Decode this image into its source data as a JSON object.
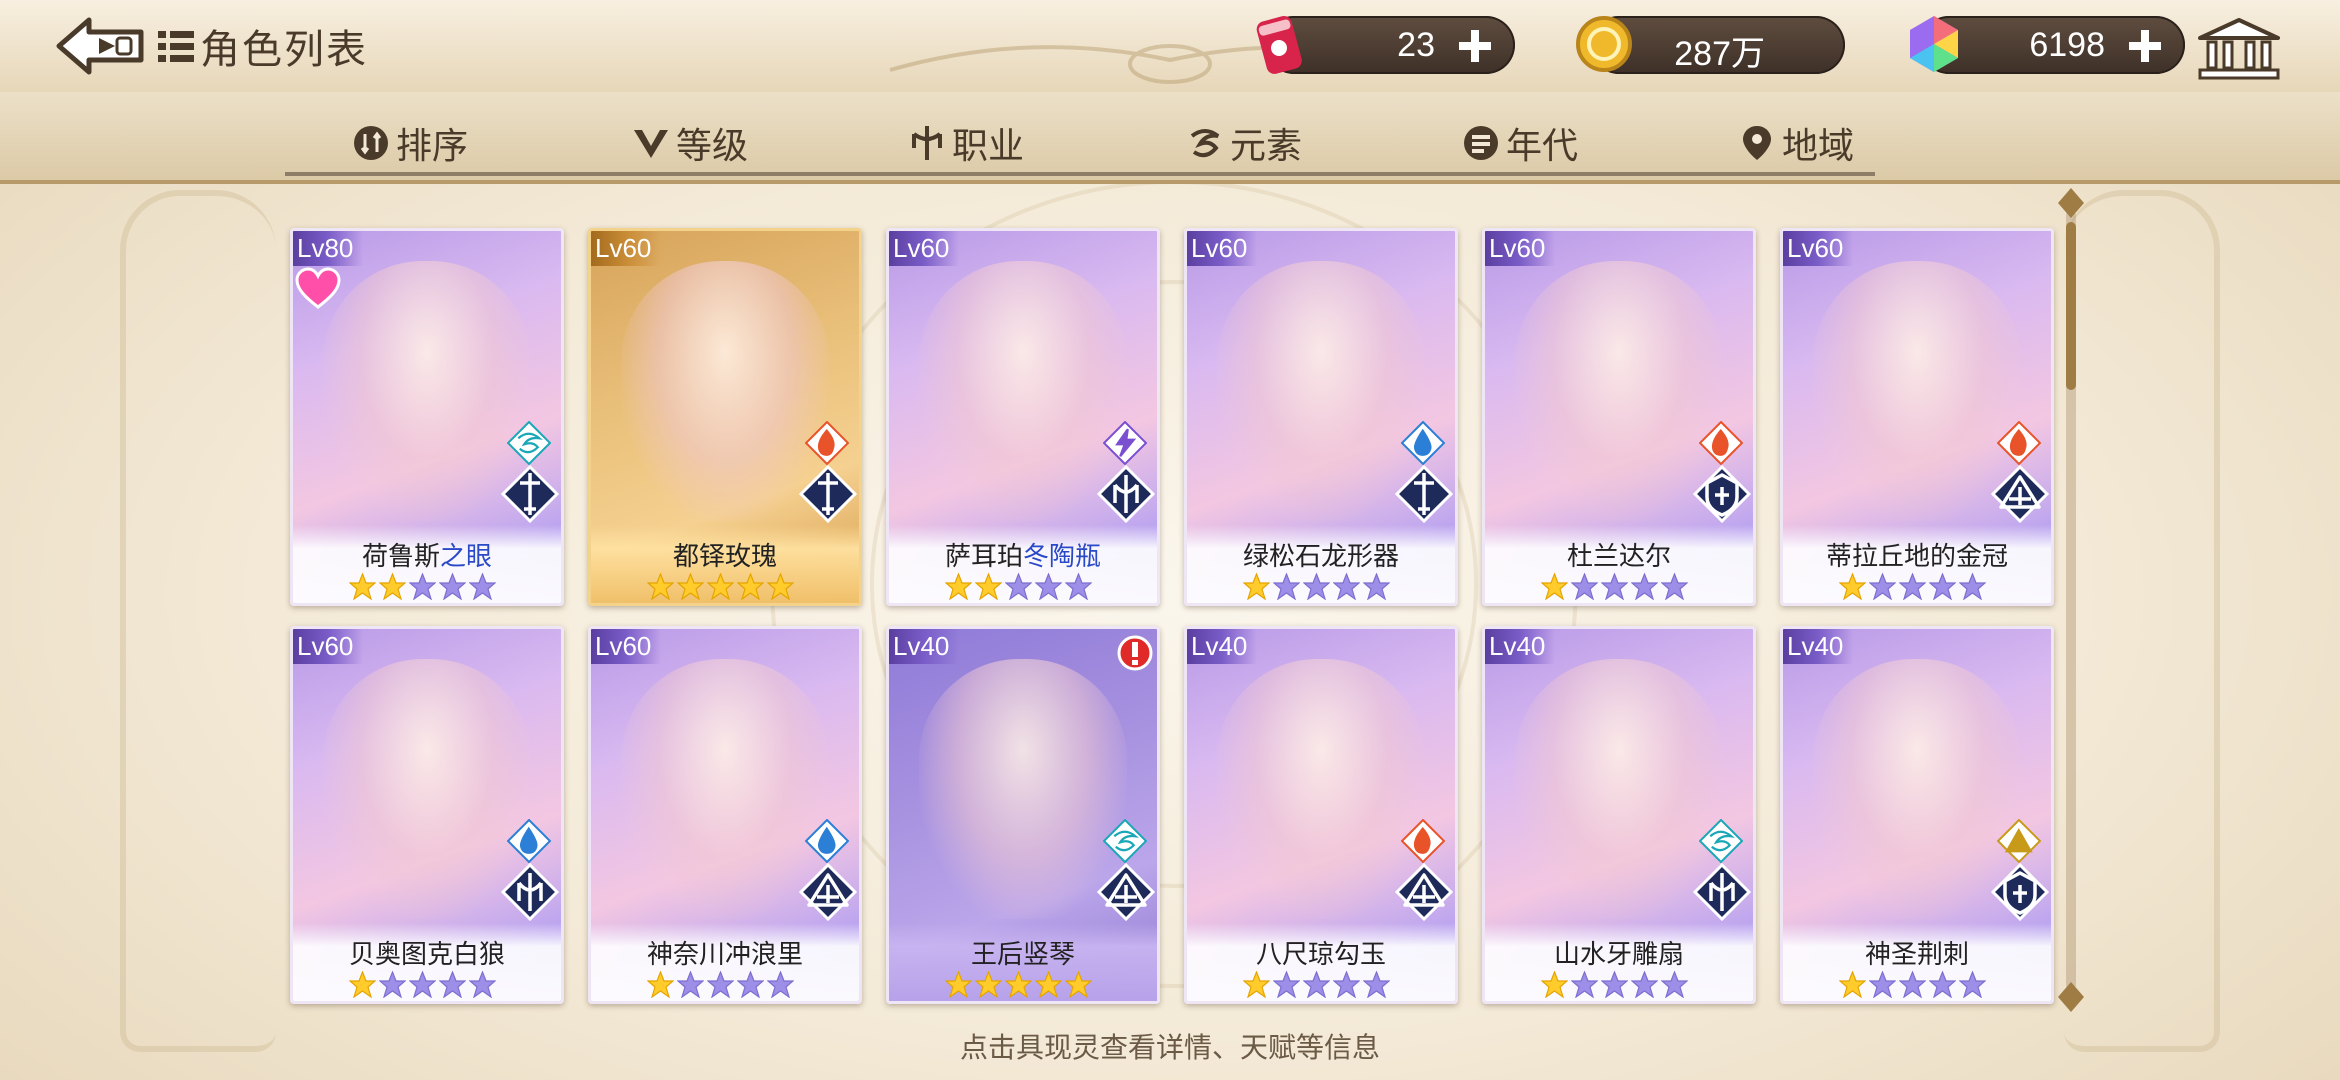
{
  "header": {
    "title": "角色列表"
  },
  "resources": {
    "ticket": "23",
    "gold": "287万",
    "gems": "6198"
  },
  "filters": [
    {
      "label": "排序",
      "icon": "sort-icon"
    },
    {
      "label": "等级",
      "icon": "level-v-icon"
    },
    {
      "label": "职业",
      "icon": "class-icon"
    },
    {
      "label": "元素",
      "icon": "element-icon"
    },
    {
      "label": "年代",
      "icon": "era-icon"
    },
    {
      "label": "地域",
      "icon": "location-pin-icon"
    }
  ],
  "cards": [
    {
      "level": "Lv80",
      "name": "荷鲁斯",
      "name_hl": "之眼",
      "stars": 2,
      "element": "wind",
      "class": "sword",
      "frame": "purple",
      "favorite": true
    },
    {
      "level": "Lv60",
      "name": "都铎玫瑰",
      "name_hl": "",
      "stars": 5,
      "element": "fire",
      "class": "sword",
      "frame": "gold"
    },
    {
      "level": "Lv60",
      "name": "萨耳珀",
      "name_hl": "冬陶瓶",
      "stars": 2,
      "element": "lightning",
      "class": "claw",
      "frame": "purple"
    },
    {
      "level": "Lv60",
      "name": "绿松石龙形器",
      "name_hl": "",
      "stars": 1,
      "element": "water",
      "class": "sword",
      "frame": "purple"
    },
    {
      "level": "Lv60",
      "name": "杜兰达尔",
      "name_hl": "",
      "stars": 1,
      "element": "fire",
      "class": "shield",
      "frame": "purple"
    },
    {
      "level": "Lv60",
      "name": "蒂拉丘地的金冠",
      "name_hl": "",
      "stars": 1,
      "element": "fire",
      "class": "book",
      "frame": "purple"
    },
    {
      "level": "Lv60",
      "name": "贝奥图克白狼",
      "name_hl": "",
      "stars": 1,
      "element": "water",
      "class": "claw",
      "frame": "purple"
    },
    {
      "level": "Lv60",
      "name": "神奈川冲浪里",
      "name_hl": "",
      "stars": 1,
      "element": "water",
      "class": "book",
      "frame": "purple"
    },
    {
      "level": "Lv40",
      "name": "王后竖琴",
      "name_hl": "",
      "stars": 5,
      "element": "wind",
      "class": "book",
      "frame": "purple-solid",
      "alert": true
    },
    {
      "level": "Lv40",
      "name": "八尺琼勾玉",
      "name_hl": "",
      "stars": 1,
      "element": "fire",
      "class": "book",
      "frame": "purple"
    },
    {
      "level": "Lv40",
      "name": "山水牙雕扇",
      "name_hl": "",
      "stars": 1,
      "element": "wind",
      "class": "claw",
      "frame": "purple"
    },
    {
      "level": "Lv40",
      "name": "神圣荆刺",
      "name_hl": "",
      "stars": 1,
      "element": "earth",
      "class": "shield",
      "frame": "purple"
    }
  ],
  "hint": "点击具现灵查看详情、天赋等信息",
  "colors": {
    "accent_gold": "#b79a68",
    "name_highlight": "#2a49c7",
    "star_gold": "#ffcc2b"
  }
}
